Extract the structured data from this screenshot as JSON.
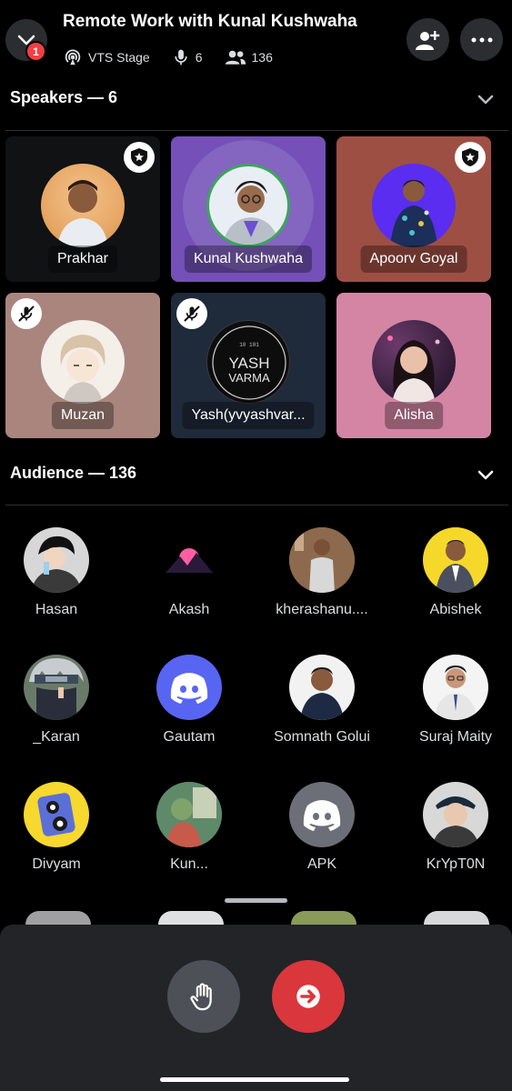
{
  "header": {
    "notification_count": "1",
    "title": "Remote Work with Kunal Kushwaha",
    "stage_channel": "VTS Stage",
    "speaker_count": "6",
    "listener_count": "136"
  },
  "speakers_section": {
    "label": "Speakers — 6"
  },
  "speakers": [
    {
      "name": "Prakhar",
      "moderator": true,
      "muted": false
    },
    {
      "name": "Kunal Kushwaha",
      "moderator": false,
      "muted": false,
      "speaking": true
    },
    {
      "name": "Apoorv Goyal",
      "moderator": true,
      "muted": false
    },
    {
      "name": "Muzan",
      "moderator": false,
      "muted": true
    },
    {
      "name": "Yash(yvyashvar...",
      "moderator": false,
      "muted": true,
      "avatar_text": "YASH VARMA"
    },
    {
      "name": "Alisha",
      "moderator": false,
      "muted": false
    }
  ],
  "audience_section": {
    "label": "Audience — 136"
  },
  "audience": [
    {
      "name": "Hasan"
    },
    {
      "name": "Akash"
    },
    {
      "name": "kherashanu...."
    },
    {
      "name": "Abishek"
    },
    {
      "name": "_Karan"
    },
    {
      "name": "Gautam"
    },
    {
      "name": "Somnath Golui"
    },
    {
      "name": "Suraj Maity"
    },
    {
      "name": "Divyam"
    },
    {
      "name": "Kun..."
    },
    {
      "name": "APK"
    },
    {
      "name": "KrYpT0N"
    }
  ],
  "colors": {
    "brand_blurple": "#5865f2",
    "leave_red": "#da373c",
    "speaking_green": "#3ba55d"
  }
}
